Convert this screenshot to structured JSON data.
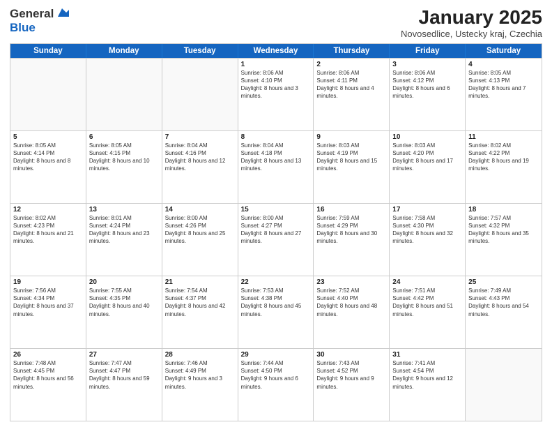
{
  "header": {
    "logo": {
      "line1": "General",
      "line2": "Blue"
    },
    "title": "January 2025",
    "subtitle": "Novosedlice, Ustecky kraj, Czechia"
  },
  "weekdays": [
    "Sunday",
    "Monday",
    "Tuesday",
    "Wednesday",
    "Thursday",
    "Friday",
    "Saturday"
  ],
  "rows": [
    [
      {
        "day": "",
        "info": "",
        "empty": true
      },
      {
        "day": "",
        "info": "",
        "empty": true
      },
      {
        "day": "",
        "info": "",
        "empty": true
      },
      {
        "day": "1",
        "info": "Sunrise: 8:06 AM\nSunset: 4:10 PM\nDaylight: 8 hours and 3 minutes."
      },
      {
        "day": "2",
        "info": "Sunrise: 8:06 AM\nSunset: 4:11 PM\nDaylight: 8 hours and 4 minutes."
      },
      {
        "day": "3",
        "info": "Sunrise: 8:06 AM\nSunset: 4:12 PM\nDaylight: 8 hours and 6 minutes."
      },
      {
        "day": "4",
        "info": "Sunrise: 8:05 AM\nSunset: 4:13 PM\nDaylight: 8 hours and 7 minutes."
      }
    ],
    [
      {
        "day": "5",
        "info": "Sunrise: 8:05 AM\nSunset: 4:14 PM\nDaylight: 8 hours and 8 minutes."
      },
      {
        "day": "6",
        "info": "Sunrise: 8:05 AM\nSunset: 4:15 PM\nDaylight: 8 hours and 10 minutes."
      },
      {
        "day": "7",
        "info": "Sunrise: 8:04 AM\nSunset: 4:16 PM\nDaylight: 8 hours and 12 minutes."
      },
      {
        "day": "8",
        "info": "Sunrise: 8:04 AM\nSunset: 4:18 PM\nDaylight: 8 hours and 13 minutes."
      },
      {
        "day": "9",
        "info": "Sunrise: 8:03 AM\nSunset: 4:19 PM\nDaylight: 8 hours and 15 minutes."
      },
      {
        "day": "10",
        "info": "Sunrise: 8:03 AM\nSunset: 4:20 PM\nDaylight: 8 hours and 17 minutes."
      },
      {
        "day": "11",
        "info": "Sunrise: 8:02 AM\nSunset: 4:22 PM\nDaylight: 8 hours and 19 minutes."
      }
    ],
    [
      {
        "day": "12",
        "info": "Sunrise: 8:02 AM\nSunset: 4:23 PM\nDaylight: 8 hours and 21 minutes."
      },
      {
        "day": "13",
        "info": "Sunrise: 8:01 AM\nSunset: 4:24 PM\nDaylight: 8 hours and 23 minutes."
      },
      {
        "day": "14",
        "info": "Sunrise: 8:00 AM\nSunset: 4:26 PM\nDaylight: 8 hours and 25 minutes."
      },
      {
        "day": "15",
        "info": "Sunrise: 8:00 AM\nSunset: 4:27 PM\nDaylight: 8 hours and 27 minutes."
      },
      {
        "day": "16",
        "info": "Sunrise: 7:59 AM\nSunset: 4:29 PM\nDaylight: 8 hours and 30 minutes."
      },
      {
        "day": "17",
        "info": "Sunrise: 7:58 AM\nSunset: 4:30 PM\nDaylight: 8 hours and 32 minutes."
      },
      {
        "day": "18",
        "info": "Sunrise: 7:57 AM\nSunset: 4:32 PM\nDaylight: 8 hours and 35 minutes."
      }
    ],
    [
      {
        "day": "19",
        "info": "Sunrise: 7:56 AM\nSunset: 4:34 PM\nDaylight: 8 hours and 37 minutes."
      },
      {
        "day": "20",
        "info": "Sunrise: 7:55 AM\nSunset: 4:35 PM\nDaylight: 8 hours and 40 minutes."
      },
      {
        "day": "21",
        "info": "Sunrise: 7:54 AM\nSunset: 4:37 PM\nDaylight: 8 hours and 42 minutes."
      },
      {
        "day": "22",
        "info": "Sunrise: 7:53 AM\nSunset: 4:38 PM\nDaylight: 8 hours and 45 minutes."
      },
      {
        "day": "23",
        "info": "Sunrise: 7:52 AM\nSunset: 4:40 PM\nDaylight: 8 hours and 48 minutes."
      },
      {
        "day": "24",
        "info": "Sunrise: 7:51 AM\nSunset: 4:42 PM\nDaylight: 8 hours and 51 minutes."
      },
      {
        "day": "25",
        "info": "Sunrise: 7:49 AM\nSunset: 4:43 PM\nDaylight: 8 hours and 54 minutes."
      }
    ],
    [
      {
        "day": "26",
        "info": "Sunrise: 7:48 AM\nSunset: 4:45 PM\nDaylight: 8 hours and 56 minutes."
      },
      {
        "day": "27",
        "info": "Sunrise: 7:47 AM\nSunset: 4:47 PM\nDaylight: 8 hours and 59 minutes."
      },
      {
        "day": "28",
        "info": "Sunrise: 7:46 AM\nSunset: 4:49 PM\nDaylight: 9 hours and 3 minutes."
      },
      {
        "day": "29",
        "info": "Sunrise: 7:44 AM\nSunset: 4:50 PM\nDaylight: 9 hours and 6 minutes."
      },
      {
        "day": "30",
        "info": "Sunrise: 7:43 AM\nSunset: 4:52 PM\nDaylight: 9 hours and 9 minutes."
      },
      {
        "day": "31",
        "info": "Sunrise: 7:41 AM\nSunset: 4:54 PM\nDaylight: 9 hours and 12 minutes."
      },
      {
        "day": "",
        "info": "",
        "empty": true
      }
    ]
  ]
}
